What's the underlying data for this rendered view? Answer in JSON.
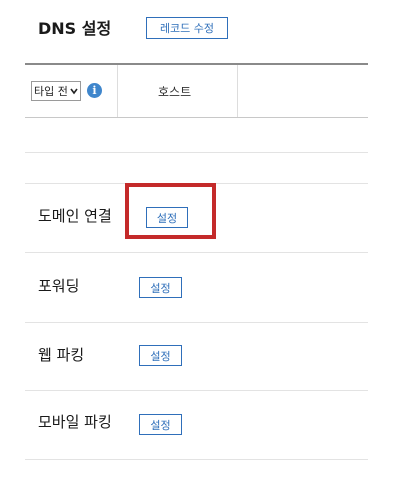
{
  "header": {
    "title": "DNS 설정",
    "edit_records_button": "레코드 수정"
  },
  "table": {
    "type_select": {
      "value": "타입 전",
      "icon": "chevron-down-icon"
    },
    "info_icon": {
      "glyph": "i",
      "icon": "info-icon"
    },
    "host_column": "호스트"
  },
  "rows": [
    {
      "label": "도메인 연결",
      "button": "설정"
    },
    {
      "label": "포워딩",
      "button": "설정"
    },
    {
      "label": "웹 파킹",
      "button": "설정"
    },
    {
      "label": "모바일 파킹",
      "button": "설정"
    }
  ],
  "colors": {
    "accent": "#2f6fba",
    "highlight": "#c42a2a"
  }
}
